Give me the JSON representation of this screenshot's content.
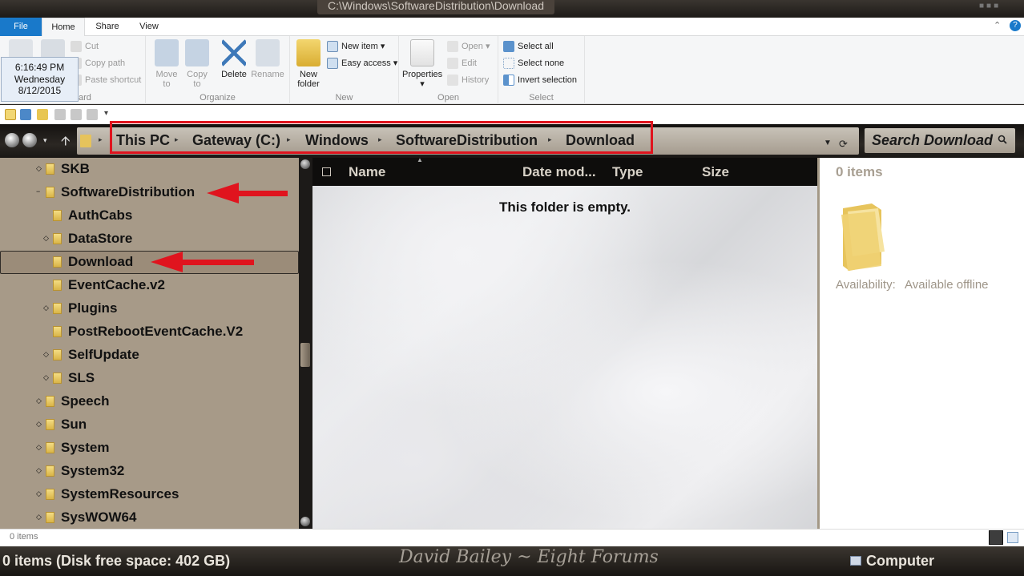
{
  "window": {
    "title": "C:\\Windows\\SoftwareDistribution\\Download"
  },
  "ribbon_tabs": {
    "file": "File",
    "home": "Home",
    "share": "Share",
    "view": "View"
  },
  "clock": {
    "time": "6:16:49 PM",
    "day": "Wednesday",
    "date": "8/12/2015"
  },
  "ribbon": {
    "clipboard": {
      "cut": "Cut",
      "copy_path": "Copy path",
      "paste_shortcut": "Paste shortcut",
      "label_fragment": "ard"
    },
    "organize": {
      "move_to_1": "Move",
      "move_to_2": "to",
      "copy_to_1": "Copy",
      "copy_to_2": "to",
      "delete": "Delete",
      "rename": "Rename",
      "label": "Organize"
    },
    "new": {
      "new_folder_1": "New",
      "new_folder_2": "folder",
      "new_item": "New item",
      "easy_access": "Easy access",
      "label": "New"
    },
    "open": {
      "properties": "Properties",
      "open": "Open",
      "edit": "Edit",
      "history": "History",
      "label": "Open"
    },
    "select": {
      "select_all": "Select all",
      "select_none": "Select none",
      "invert_selection": "Invert selection",
      "label": "Select"
    }
  },
  "address": {
    "crumbs": [
      "This PC",
      "Gateway (C:)",
      "Windows",
      "SoftwareDistribution",
      "Download"
    ]
  },
  "search": {
    "placeholder": "Search Download"
  },
  "nav_tree": [
    {
      "label": "SKB",
      "expander": "◇"
    },
    {
      "label": "SoftwareDistribution",
      "expander": "−"
    },
    {
      "label": "AuthCabs",
      "expander": ""
    },
    {
      "label": "DataStore",
      "expander": "◇"
    },
    {
      "label": "Download",
      "expander": ""
    },
    {
      "label": "EventCache.v2",
      "expander": ""
    },
    {
      "label": "Plugins",
      "expander": "◇"
    },
    {
      "label": "PostRebootEventCache.V2",
      "expander": ""
    },
    {
      "label": "SelfUpdate",
      "expander": "◇"
    },
    {
      "label": "SLS",
      "expander": "◇"
    },
    {
      "label": "Speech",
      "expander": "◇"
    },
    {
      "label": "Sun",
      "expander": "◇"
    },
    {
      "label": "System",
      "expander": "◇"
    },
    {
      "label": "System32",
      "expander": "◇"
    },
    {
      "label": "SystemResources",
      "expander": "◇"
    },
    {
      "label": "SysWOW64",
      "expander": "◇"
    }
  ],
  "columns": {
    "name": "Name",
    "date": "Date mod...",
    "type": "Type",
    "size": "Size"
  },
  "file_pane": {
    "empty_message": "This folder is empty."
  },
  "details": {
    "count": "0 items",
    "availability_label": "Availability:",
    "availability_value": "Available offline"
  },
  "status": {
    "items": "0 items"
  },
  "bottom": {
    "left": "0 items (Disk free space: 402 GB)",
    "center": "David Bailey ~ Eight Forums",
    "right": "Computer"
  },
  "colors": {
    "highlight_red": "#e0141e",
    "file_tab_blue": "#1979ca",
    "nav_bg": "#a79a88"
  }
}
